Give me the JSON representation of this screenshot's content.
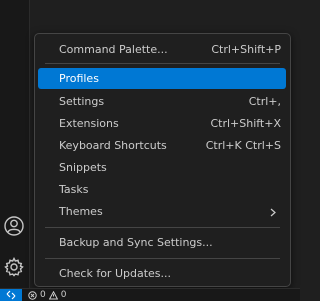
{
  "menu": {
    "items": [
      {
        "label": "Command Palette...",
        "shortcut": "Ctrl+Shift+P"
      },
      {
        "label": "Profiles",
        "shortcut": ""
      },
      {
        "label": "Settings",
        "shortcut": "Ctrl+,"
      },
      {
        "label": "Extensions",
        "shortcut": "Ctrl+Shift+X"
      },
      {
        "label": "Keyboard Shortcuts",
        "shortcut": "Ctrl+K Ctrl+S"
      },
      {
        "label": "Snippets",
        "shortcut": ""
      },
      {
        "label": "Tasks",
        "shortcut": ""
      },
      {
        "label": "Themes",
        "shortcut": ""
      },
      {
        "label": "Backup and Sync Settings...",
        "shortcut": ""
      },
      {
        "label": "Check for Updates...",
        "shortcut": ""
      }
    ],
    "active_item": "Profiles",
    "submenu_indicator": "›"
  },
  "status_bar": {
    "errors": "0",
    "warnings": "0"
  },
  "activity_bar": {
    "icons": [
      "accounts-icon",
      "manage-gear-icon"
    ]
  },
  "colors": {
    "accent": "#0078d4",
    "menu_bg": "#1f1f1f",
    "text": "#cccccc"
  }
}
